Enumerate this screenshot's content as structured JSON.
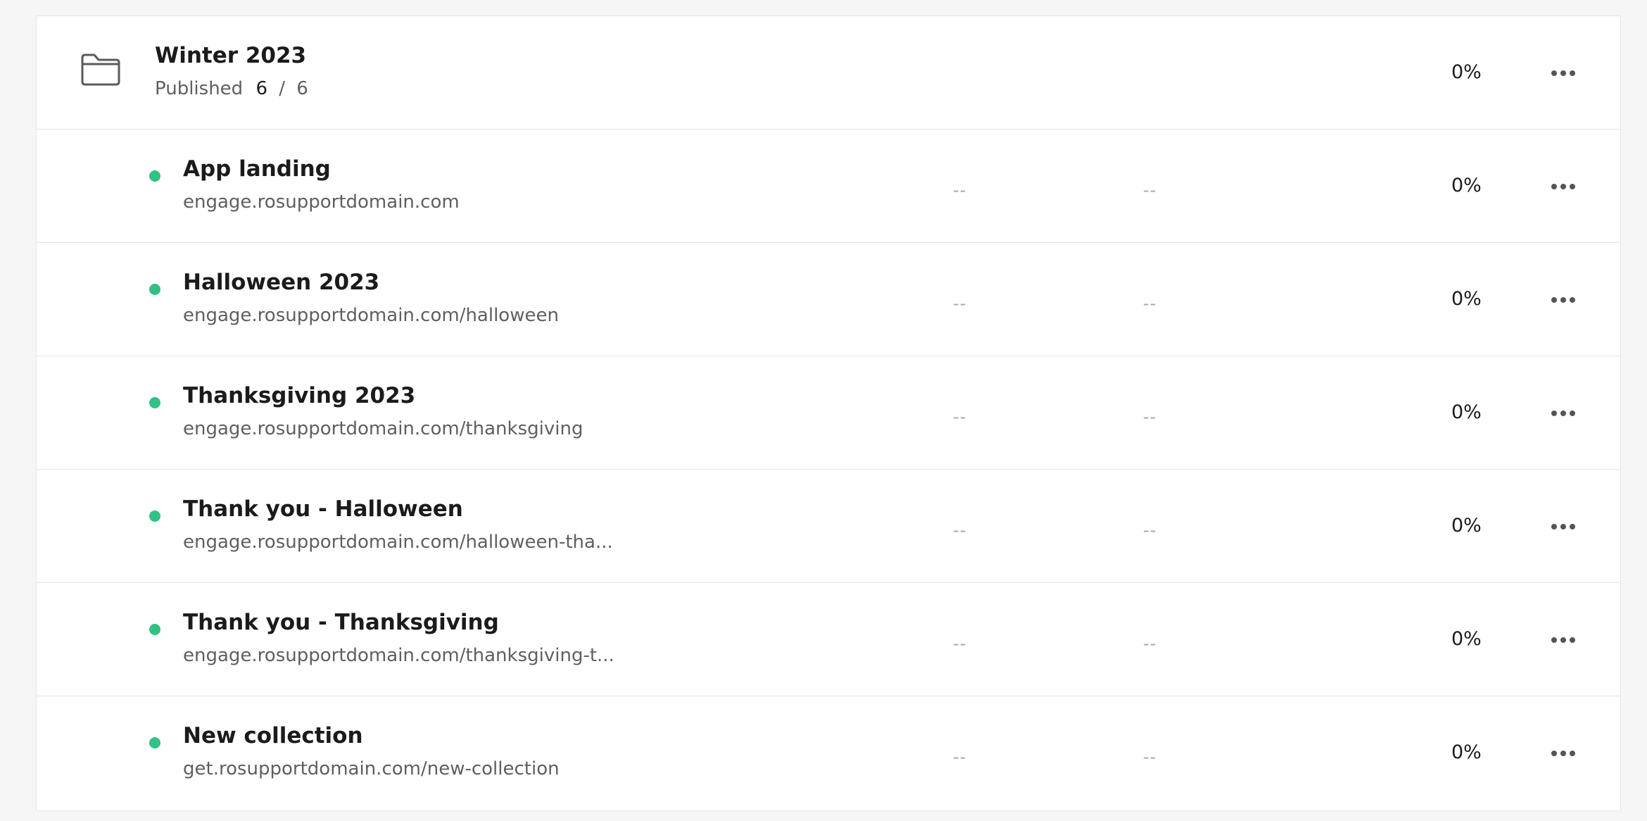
{
  "group": {
    "title": "Winter 2023",
    "published_label": "Published",
    "published_count": "6",
    "separator": "/",
    "published_total": "6",
    "percent": "0%",
    "icon": "folder-icon",
    "more_icon": "more-horizontal-icon"
  },
  "items": [
    {
      "title": "App landing",
      "url": "engage.rosupportdomain.com",
      "metric_a": "--",
      "metric_b": "--",
      "percent": "0%",
      "status_color": "#2fc284"
    },
    {
      "title": "Halloween 2023",
      "url": "engage.rosupportdomain.com/halloween",
      "metric_a": "--",
      "metric_b": "--",
      "percent": "0%",
      "status_color": "#2fc284"
    },
    {
      "title": "Thanksgiving 2023",
      "url": "engage.rosupportdomain.com/thanksgiving",
      "metric_a": "--",
      "metric_b": "--",
      "percent": "0%",
      "status_color": "#2fc284"
    },
    {
      "title": "Thank you - Halloween",
      "url": "engage.rosupportdomain.com/halloween-tha...",
      "metric_a": "--",
      "metric_b": "--",
      "percent": "0%",
      "status_color": "#2fc284"
    },
    {
      "title": "Thank you - Thanksgiving",
      "url": "engage.rosupportdomain.com/thanksgiving-t...",
      "metric_a": "--",
      "metric_b": "--",
      "percent": "0%",
      "status_color": "#2fc284"
    },
    {
      "title": "New collection",
      "url": "get.rosupportdomain.com/new-collection",
      "metric_a": "--",
      "metric_b": "--",
      "percent": "0%",
      "status_color": "#2fc284"
    }
  ]
}
